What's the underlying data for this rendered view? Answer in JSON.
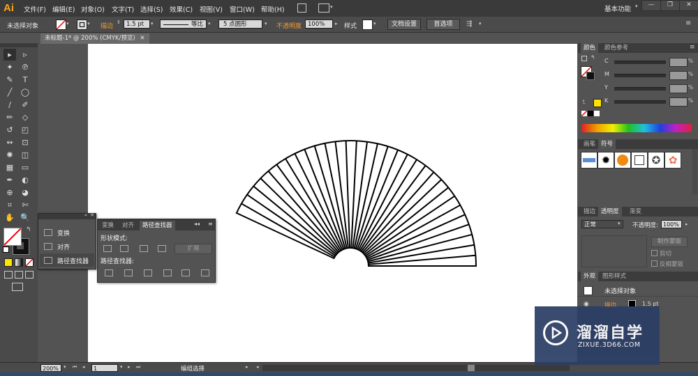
{
  "app": {
    "logo": "Ai"
  },
  "menu": [
    "文件(F)",
    "编辑(E)",
    "对象(O)",
    "文字(T)",
    "选择(S)",
    "效果(C)",
    "视图(V)",
    "窗口(W)",
    "帮助(H)"
  ],
  "workspace": {
    "label": "基本功能"
  },
  "window_controls": [
    "—",
    "❐",
    "✕"
  ],
  "control_bar": {
    "selection": "未选择对象",
    "stroke_label": "描边",
    "stroke_value": "1.5 pt",
    "profile_label": "等比",
    "brush_value": "5 点圆形",
    "opacity_label": "不透明度",
    "opacity_value": "100%",
    "style_label": "样式",
    "doc_setup": "文档设置",
    "prefs": "首选项"
  },
  "document_tab": {
    "title": "未标题-1* @ 200% (CMYK/预览)",
    "close": "✕"
  },
  "tools_panel": {
    "tools": [
      "▸",
      "▹",
      "✦",
      "℗",
      "✎",
      "T",
      "╱",
      "◯",
      "∕",
      "✐",
      "✏",
      "◇",
      "↺",
      "◰",
      "↭",
      "⊡",
      "✺",
      "◫",
      "▦",
      "▭",
      "✒",
      "◐",
      "⊕",
      "◕",
      "⌗",
      "✄",
      "✋",
      "🔍"
    ]
  },
  "float_panel_small": {
    "items": [
      {
        "label": "变换",
        "icon": "transform-icon"
      },
      {
        "label": "对齐",
        "icon": "align-icon"
      },
      {
        "label": "路径查找器",
        "icon": "pathfinder-icon"
      }
    ]
  },
  "pathfinder_panel": {
    "tabs": [
      "变换",
      "对齐",
      "路径查找器"
    ],
    "shape_modes_label": "形状模式:",
    "expand_label": "扩展",
    "pathfinders_label": "路径查找器:"
  },
  "color_panel": {
    "tabs": [
      "颜色",
      "颜色参考"
    ],
    "channels": [
      {
        "label": "C",
        "unit": "%"
      },
      {
        "label": "M",
        "unit": "%"
      },
      {
        "label": "Y",
        "unit": "%"
      },
      {
        "label": "K",
        "unit": "%"
      }
    ]
  },
  "symbols_panel": {
    "tabs": [
      "画笔",
      "符号"
    ]
  },
  "transparency_panel": {
    "tabs": [
      "描边",
      "透明度",
      "渐变"
    ],
    "mode": "正常",
    "opacity_label": "不透明度:",
    "opacity_value": "100%",
    "make_mask": "制作蒙版",
    "clip": "剪切",
    "invert_mask": "反相蒙版"
  },
  "appearance_panel": {
    "tabs": [
      "外观",
      "图形样式"
    ],
    "title": "未选择对象",
    "stroke_label": "描边",
    "stroke_value": "1.5 pt"
  },
  "status_bar": {
    "zoom": "200%",
    "page": "1",
    "tool_status": "编组选择"
  },
  "watermark": {
    "main": "溜溜自学",
    "url": "ZIXUE.3D66.COM"
  },
  "colors": {
    "accent_orange": "#f39c32",
    "watermark_bg": "#2c3e66",
    "logo_orange": "#f7a51f"
  }
}
